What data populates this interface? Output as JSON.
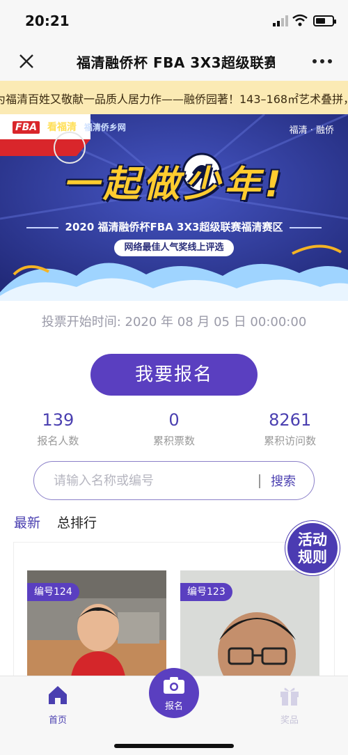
{
  "status_bar": {
    "time": "20:21",
    "battery_level_pct": 60
  },
  "nav": {
    "title": "福清融侨杯 FBA 3X3超级联赛福清赛区",
    "close_icon": "close-icon",
    "more_icon": "more-icon"
  },
  "marquee": {
    "text": "为福清百姓又敬献一品质人居力作——融侨园著！143–168㎡艺术叠拼，"
  },
  "banner": {
    "brand_fba": "FBA",
    "brand_kan": "看福清",
    "brand_net": "福清侨乡网",
    "tag": "福清 · 融侨",
    "slogan": "一起做少年!",
    "event": "2020 福清融侨杯FBA 3X3超级联赛福清赛区",
    "pill": "网络最佳人气奖线上评选"
  },
  "vote_start": "投票开始时间: 2020 年 08 月 05 日  00:00:00",
  "signup_label": "我要报名",
  "stats": [
    {
      "num": "139",
      "label": "报名人数"
    },
    {
      "num": "0",
      "label": "累积票数"
    },
    {
      "num": "8261",
      "label": "累积访问数"
    }
  ],
  "search": {
    "placeholder": "请输入名称或编号",
    "button": "搜索"
  },
  "tabs": [
    {
      "label": "最新",
      "active": true
    },
    {
      "label": "总排行",
      "active": false
    }
  ],
  "rules_badge": {
    "line1": "活动",
    "line2": "规则"
  },
  "entries": [
    {
      "id_label": "编号124"
    },
    {
      "id_label": "编号123"
    }
  ],
  "bottom_nav": {
    "home": "首页",
    "signup": "报名",
    "prize": "奖品"
  },
  "colors": {
    "accent": "#5a3fc0",
    "marquee_bg": "#fbeab4",
    "banner_bg": "#2f3a9a",
    "slogan": "#ffcc2f"
  }
}
